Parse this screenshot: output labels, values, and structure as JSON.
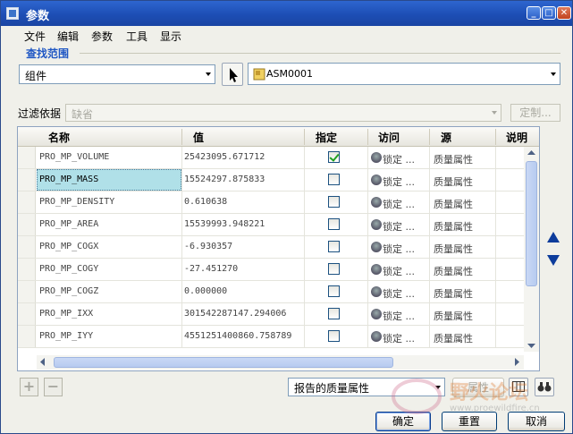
{
  "window": {
    "title": "参数",
    "min_glyph": "_",
    "max_glyph": "□",
    "close_glyph": "✕"
  },
  "menu": [
    "文件",
    "编辑",
    "参数",
    "工具",
    "显示"
  ],
  "search_scope": {
    "label": "查找范围",
    "type_value": "组件",
    "model_value": "ASM0001"
  },
  "filter": {
    "label": "过滤依据",
    "value": "缺省",
    "custom_label": "定制..."
  },
  "table": {
    "headers": [
      "名称",
      "值",
      "指定",
      "访问",
      "源",
      "说明"
    ],
    "rows": [
      {
        "name": "PRO_MP_VOLUME",
        "value": "25423095.671712",
        "designated": true,
        "access": "锁定 ...",
        "source": "质量属性"
      },
      {
        "name": "PRO_MP_MASS",
        "value": "15524297.875833",
        "designated": false,
        "access": "锁定 ...",
        "source": "质量属性"
      },
      {
        "name": "PRO_MP_DENSITY",
        "value": "0.610638",
        "designated": false,
        "access": "锁定 ...",
        "source": "质量属性"
      },
      {
        "name": "PRO_MP_AREA",
        "value": "15539993.948221",
        "designated": false,
        "access": "锁定 ...",
        "source": "质量属性"
      },
      {
        "name": "PRO_MP_COGX",
        "value": "-6.930357",
        "designated": false,
        "access": "锁定 ...",
        "source": "质量属性"
      },
      {
        "name": "PRO_MP_COGY",
        "value": "-27.451270",
        "designated": false,
        "access": "锁定 ...",
        "source": "质量属性"
      },
      {
        "name": "PRO_MP_COGZ",
        "value": "0.000000",
        "designated": false,
        "access": "锁定 ...",
        "source": "质量属性"
      },
      {
        "name": "PRO_MP_IXX",
        "value": "301542287147.294006",
        "designated": false,
        "access": "锁定 ...",
        "source": "质量属性"
      },
      {
        "name": "PRO_MP_IYY",
        "value": "4551251400860.758789",
        "designated": false,
        "access": "锁定 ...",
        "source": "质量属性"
      }
    ]
  },
  "bottom": {
    "add_glyph": "+",
    "remove_glyph": "−",
    "report_value": "报告的质量属性",
    "property_label": "属性",
    "ok_label": "确定",
    "reset_label": "重置",
    "cancel_label": "取消"
  },
  "watermark": {
    "text": "野火论坛",
    "url": "www.proewildfire.cn"
  }
}
